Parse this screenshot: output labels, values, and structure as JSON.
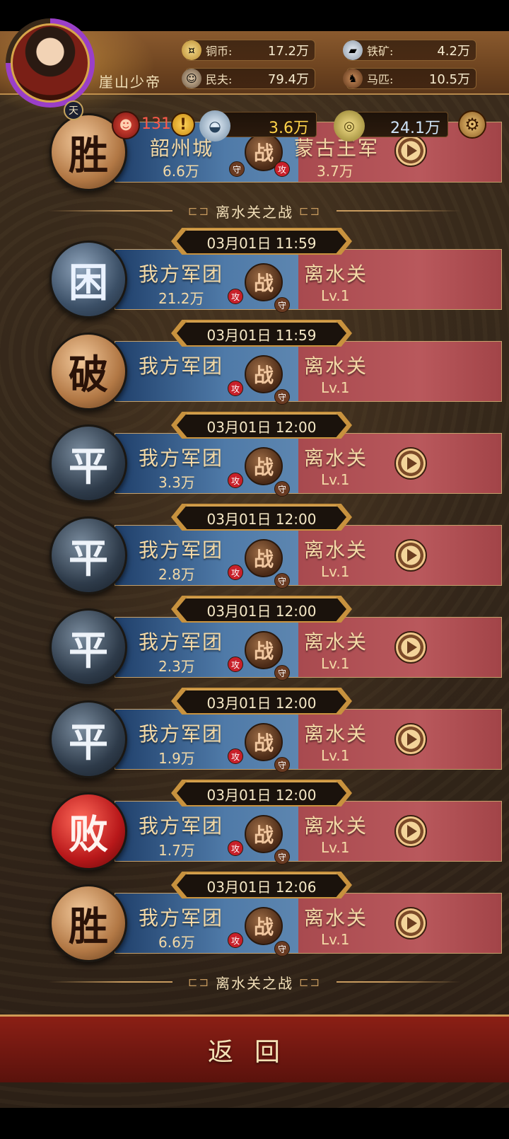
{
  "header": {
    "player_name": "崖山少帝",
    "avatar_badge": "天",
    "resources": {
      "copper": {
        "label": "铜币:",
        "value": "17.2万"
      },
      "iron": {
        "label": "铁矿:",
        "value": "4.2万"
      },
      "peasant": {
        "label": "民夫:",
        "value": "79.4万"
      },
      "horse": {
        "label": "马匹:",
        "value": "10.5万"
      }
    },
    "bar": {
      "rank": "131",
      "silver": "3.6万",
      "gold": "24.1万"
    }
  },
  "top_partial_card": {
    "left_name": "韶州城",
    "left_count": "6.6万",
    "right_name": "蒙古王军",
    "right_count": "3.7万",
    "vs": "战",
    "def_tag": "守",
    "atk_tag": "攻",
    "emblem": "胜"
  },
  "divider_top": "离水关之战",
  "battles": [
    {
      "time": "03月01日 11:59",
      "emblem": "困",
      "emblem_style": "blue",
      "left_name": "我方军团",
      "left_count": "21.2万",
      "right_name": "离水关",
      "right_level": "Lv.1",
      "left_tag": "攻",
      "right_tag": "守",
      "has_play": false
    },
    {
      "time": "03月01日 11:59",
      "emblem": "破",
      "emblem_style": "gold",
      "left_name": "我方军团",
      "left_count": "",
      "right_name": "离水关",
      "right_level": "Lv.1",
      "left_tag": "攻",
      "right_tag": "守",
      "has_play": false
    },
    {
      "time": "03月01日 12:00",
      "emblem": "平",
      "emblem_style": "grey",
      "left_name": "我方军团",
      "left_count": "3.3万",
      "right_name": "离水关",
      "right_level": "Lv.1",
      "left_tag": "攻",
      "right_tag": "守",
      "has_play": true
    },
    {
      "time": "03月01日 12:00",
      "emblem": "平",
      "emblem_style": "grey",
      "left_name": "我方军团",
      "left_count": "2.8万",
      "right_name": "离水关",
      "right_level": "Lv.1",
      "left_tag": "攻",
      "right_tag": "守",
      "has_play": true
    },
    {
      "time": "03月01日 12:00",
      "emblem": "平",
      "emblem_style": "grey",
      "left_name": "我方军团",
      "left_count": "2.3万",
      "right_name": "离水关",
      "right_level": "Lv.1",
      "left_tag": "攻",
      "right_tag": "守",
      "has_play": true
    },
    {
      "time": "03月01日 12:00",
      "emblem": "平",
      "emblem_style": "grey",
      "left_name": "我方军团",
      "left_count": "1.9万",
      "right_name": "离水关",
      "right_level": "Lv.1",
      "left_tag": "攻",
      "right_tag": "守",
      "has_play": true
    },
    {
      "time": "03月01日 12:00",
      "emblem": "败",
      "emblem_style": "red",
      "left_name": "我方军团",
      "left_count": "1.7万",
      "right_name": "离水关",
      "right_level": "Lv.1",
      "left_tag": "攻",
      "right_tag": "守",
      "has_play": true
    },
    {
      "time": "03月01日 12:06",
      "emblem": "胜",
      "emblem_style": "gold",
      "left_name": "我方军团",
      "left_count": "6.6万",
      "right_name": "离水关",
      "right_level": "Lv.1",
      "left_tag": "攻",
      "right_tag": "守",
      "has_play": true
    }
  ],
  "vs_label": "战",
  "divider_bottom": "离水关之战",
  "bottom": {
    "return_label": "返回"
  },
  "colors": {
    "blue_side": "#4f7aa8",
    "red_side": "#b9585c",
    "accent_gold": "#c79a5e",
    "bottom_red": "#8b1f15"
  }
}
